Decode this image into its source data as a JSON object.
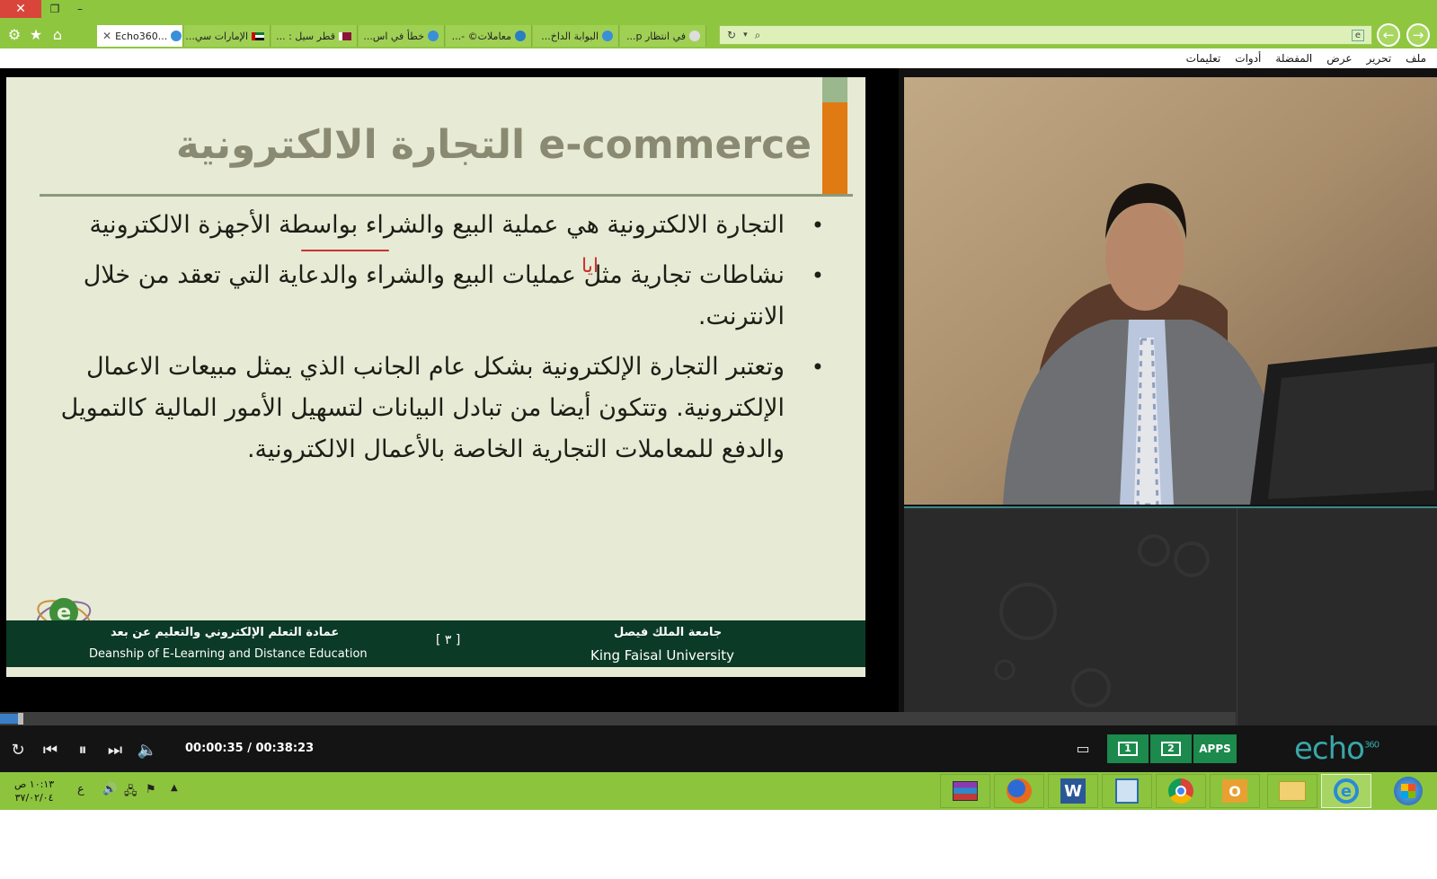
{
  "browser": {
    "tabs": [
      {
        "label": "Echo360...",
        "active": true
      },
      {
        "label": "الإمارات سي...",
        "flag": "uae"
      },
      {
        "label": "قطر سيل : ...",
        "flag": "qatar"
      },
      {
        "label": "خطأ في اس..."
      },
      {
        "label": "معاملات© -..."
      },
      {
        "label": "البوابة الداخ..."
      },
      {
        "label": "في انتظار p..."
      }
    ],
    "menu": [
      "ملف",
      "تحرير",
      "عرض",
      "المفضلة",
      "أدوات",
      "تعليمات"
    ]
  },
  "slide": {
    "title": "التجارة الالكترونية  e-commerce",
    "bullets": [
      "التجارة الالكترونية هي عملية البيع والشراء بواسطة الأجهزة الالكترونية",
      "نشاطات تجارية مثل عمليات البيع والشراء والدعاية التي تعقد من خلال الانترنت.",
      "وتعتبر التجارة الإلكترونية بشكل عام الجانب الذي يمثل مبيعات الاعمال الإلكترونية. وتتكون أيضا من تبادل البيانات لتسهيل الأمور المالية كالتمويل والدفع للمعاملات التجارية الخاصة بالأعمال الالكترونية."
    ],
    "annotation": "ايا",
    "footer": {
      "deanship_ar": "عمادة التعلم الإلكتروني والتعليم عن بعد",
      "deanship_en": "Deanship of E-Learning and Distance Education",
      "page": "[ ٣ ]",
      "university_ar": "جامعة الملك فيصل",
      "university_en": "King Faisal University"
    }
  },
  "player": {
    "timecode": "00:00:35 / 00:38:23",
    "progress": 0.015,
    "view_buttons": [
      "1",
      "2",
      "APPS"
    ],
    "logo": "echo",
    "logo_sup": "360"
  },
  "taskbar": {
    "clock_time": "١٠:١٣ ص",
    "clock_date": "٣٧/٠٢/٠٤",
    "lang": "ع"
  },
  "colors": {
    "chrome_green": "#8fc63f",
    "slide_bg": "#e7ead4",
    "footer_green": "#0b3a26",
    "accent_orange": "#e07a12",
    "echo_teal": "#3aa6a8",
    "view_green": "#1b8a4c"
  }
}
